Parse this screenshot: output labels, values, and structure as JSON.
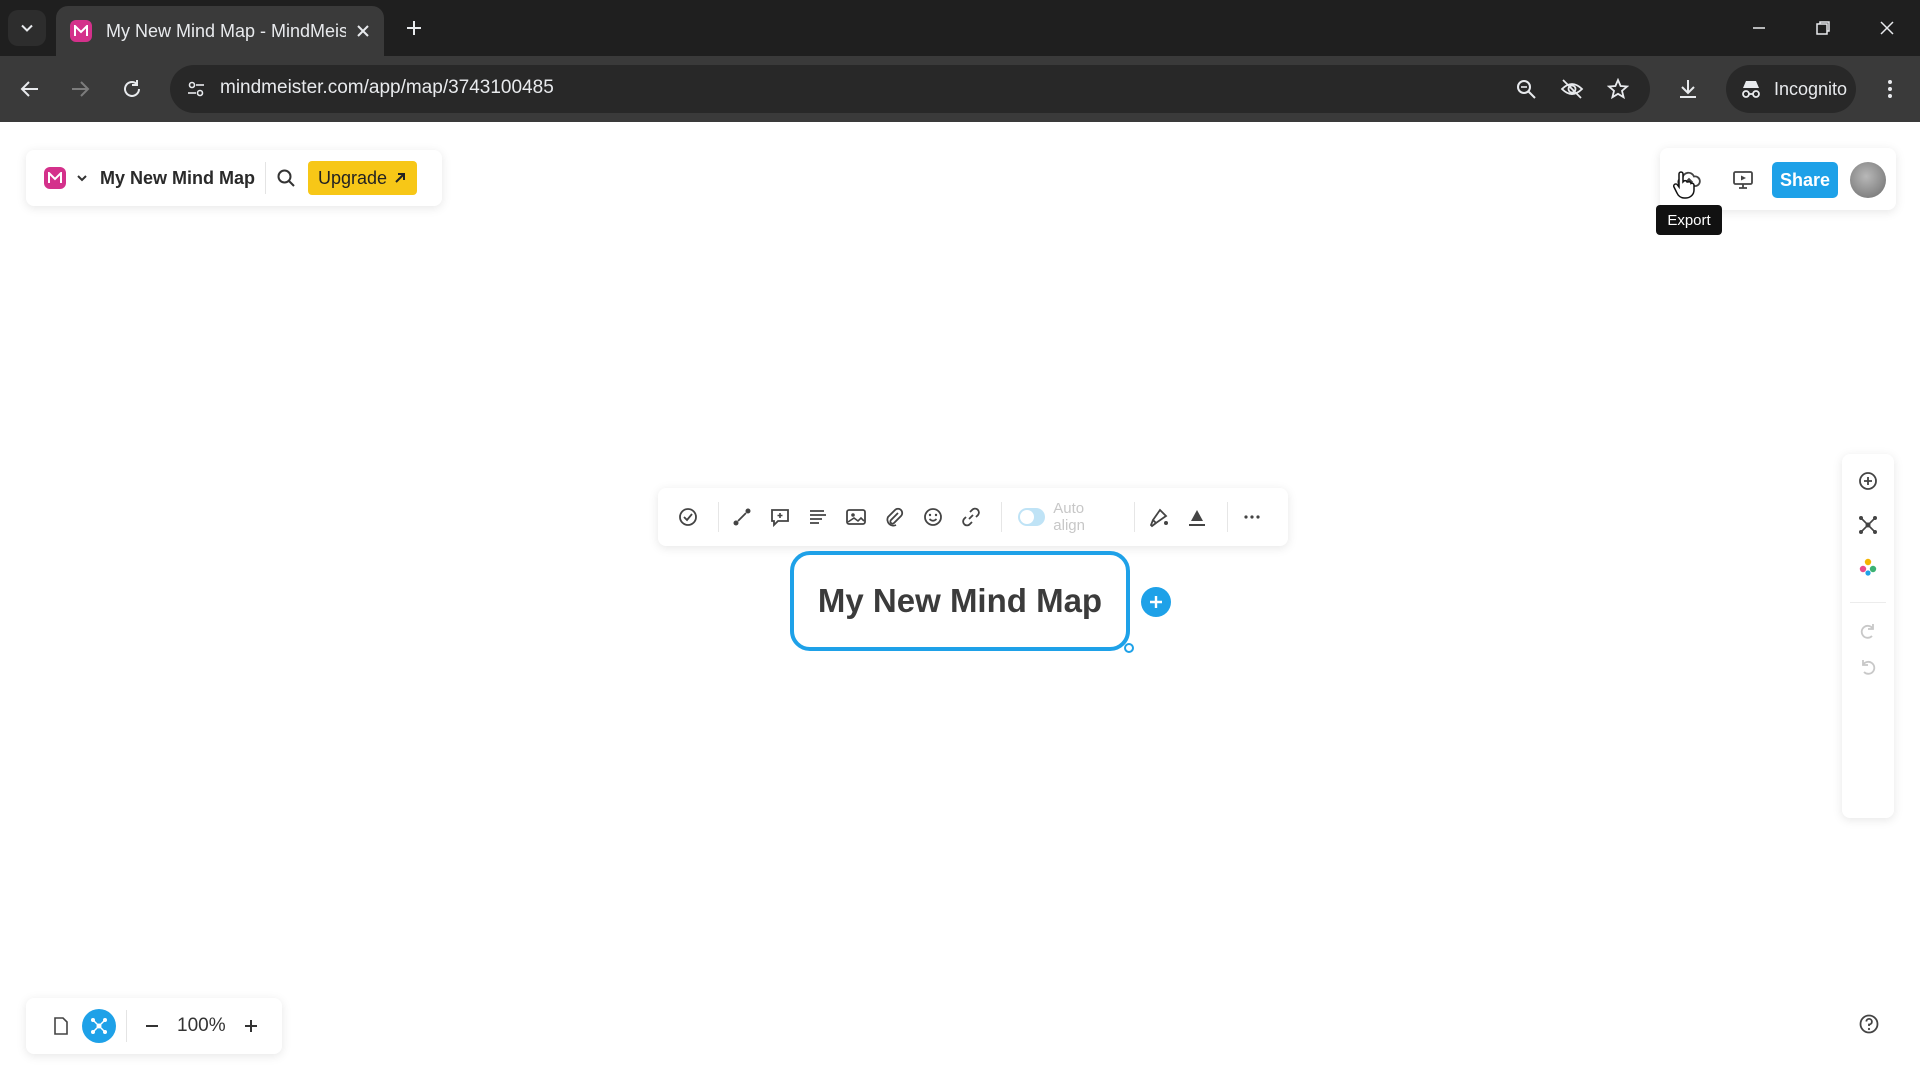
{
  "browser": {
    "tab_title": "My New Mind Map - MindMeister",
    "url": "mindmeister.com/app/map/3743100485",
    "incognito_label": "Incognito"
  },
  "app": {
    "map_title": "My New Mind Map",
    "upgrade_label": "Upgrade",
    "share_label": "Share",
    "tooltip_text": "Export",
    "auto_align_label": "Auto align",
    "auto_align_enabled": true,
    "root_node_text": "My New Mind Map",
    "zoom_level": "100%",
    "accent_color": "#1ea1e8",
    "upgrade_color": "#f7c717",
    "brand_color": "#d4318b"
  },
  "icons": {
    "toolbar": [
      "task-check-icon",
      "connect-icon",
      "comment-icon",
      "notes-icon",
      "image-icon",
      "attachment-icon",
      "emoji-icon",
      "link-icon",
      "style-icon",
      "text-color-icon",
      "more-icon"
    ],
    "top_right": [
      "export-icon",
      "present-icon"
    ],
    "side_panel": [
      "add-topic-icon",
      "layout-icon",
      "theme-icon",
      "redo-icon",
      "undo-icon"
    ],
    "bottom": [
      "outline-view-icon",
      "mindmap-view-icon",
      "zoom-out-icon",
      "zoom-in-icon",
      "help-icon"
    ]
  }
}
